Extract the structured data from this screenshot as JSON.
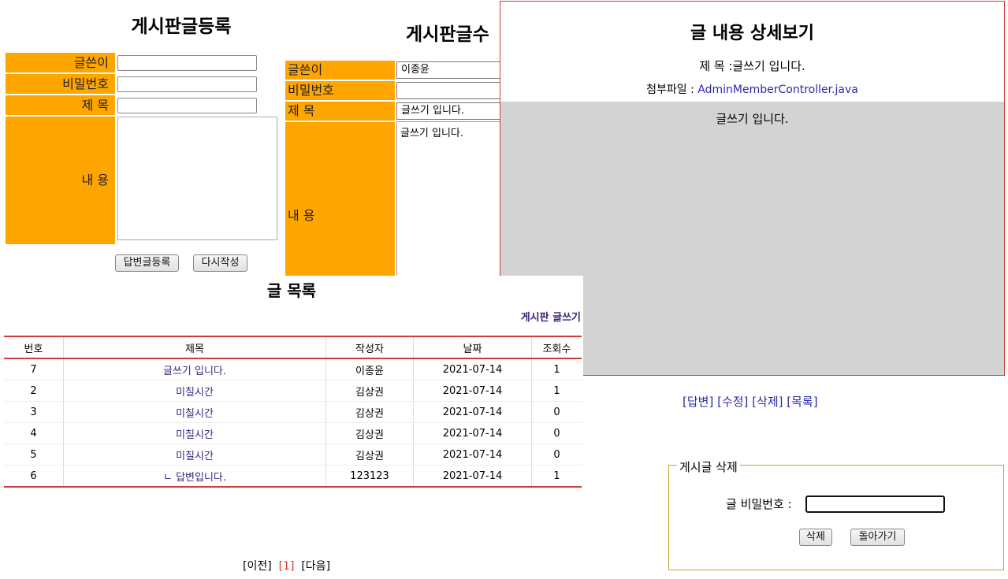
{
  "register": {
    "title": "게시판글등록",
    "labels": {
      "writer": "글쓴이",
      "password": "비밀번호",
      "subject": "제 목",
      "content": "내 용"
    },
    "buttons": {
      "submit": "답변글등록",
      "reset": "다시작성"
    }
  },
  "modify": {
    "title": "게시판글수",
    "labels": {
      "writer": "글쓴이",
      "password": "비밀번호",
      "subject": "제 목",
      "content": "내 용"
    },
    "values": {
      "writer": "이종윤",
      "password": "",
      "subject": "글쓰기 입니다.",
      "content": "글쓰기 입니다."
    }
  },
  "detail": {
    "title": "글 내용 상세보기",
    "subject_label": "제 목 :",
    "subject": "글쓰기 입니다.",
    "file_label": "첨부파일 :",
    "file_name": "AdminMemberController.java",
    "content": "글쓰기 입니다.",
    "links": [
      "[답변]",
      "[수정]",
      "[삭제]",
      "[목록]"
    ]
  },
  "list": {
    "title": "글 목록",
    "write_link": "게시판 글쓰기",
    "columns": [
      "번호",
      "제목",
      "작성자",
      "날짜",
      "조회수"
    ],
    "rows": [
      [
        "7",
        "글쓰기 입니다.",
        "이종윤",
        "2021-07-14",
        "1"
      ],
      [
        "2",
        "미칠시간",
        "김상권",
        "2021-07-14",
        "1"
      ],
      [
        "3",
        "미칠시간",
        "김상권",
        "2021-07-14",
        "0"
      ],
      [
        "4",
        "미칠시간",
        "김상권",
        "2021-07-14",
        "0"
      ],
      [
        "5",
        "미칠시간",
        "김상권",
        "2021-07-14",
        "0"
      ],
      [
        "6",
        "ㄴ 답변입니다.",
        "123123",
        "2021-07-14",
        "1"
      ]
    ],
    "pager": {
      "prev": "[이전]",
      "current": "[1]",
      "next": "[다음]"
    }
  },
  "delete": {
    "legend": "게시글 삭제",
    "password_label": "글 비밀번호 :",
    "password_value": "",
    "buttons": {
      "delete": "삭제",
      "back": "돌아가기"
    }
  },
  "colors": {
    "label_bg": "#FFA500",
    "rule_red": "#d23a3a",
    "content_gray": "#d3d3d3",
    "fieldset_border": "#c9a227"
  }
}
